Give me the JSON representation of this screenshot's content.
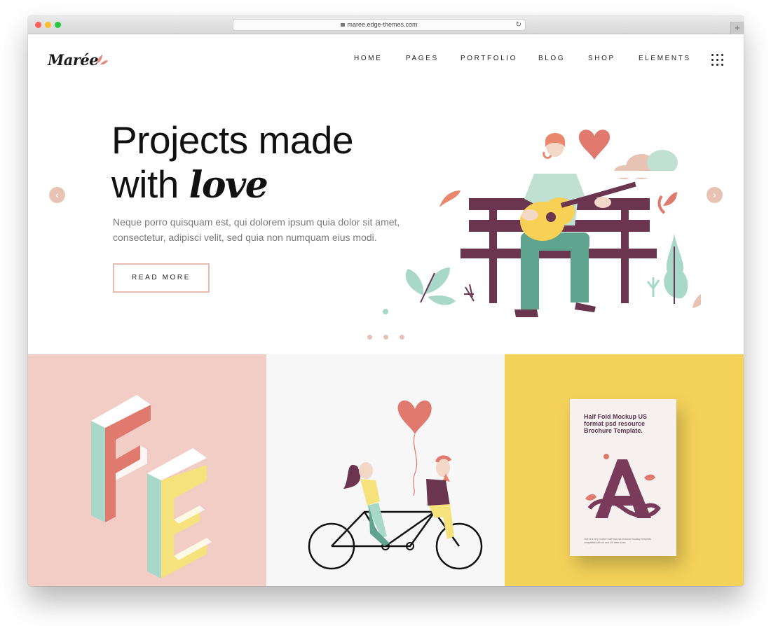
{
  "browser": {
    "url": "maree.edge-themes.com",
    "newtab_label": "+"
  },
  "header": {
    "logo": "Marée",
    "nav": [
      {
        "label": "HOME",
        "active": true
      },
      {
        "label": "PAGES"
      },
      {
        "label": "PORTFOLIO"
      },
      {
        "label": "BLOG"
      },
      {
        "label": "SHOP"
      },
      {
        "label": "ELEMENTS"
      }
    ]
  },
  "hero": {
    "title_line1": "Projects made",
    "title_line2_plain": "with",
    "title_line2_emphasis": "love",
    "text": "Neque porro quisquam est, qui dolorem ipsum quia dolor sit amet, consectetur, adipisci velit, sed quia non numquam eius modi.",
    "button": "READ MORE",
    "prev_icon": "‹",
    "next_icon": "›",
    "slide_count": 3,
    "active_slide": 1
  },
  "tiles": {
    "tile3": {
      "brochure_text": "Half Fold Mockup US format psd resource Brochure Template.",
      "brochure_small": "This is a very modern half fold psd brochure mockup template compatible with A4 and US letter sizes."
    }
  },
  "colors": {
    "accent": "#e8c3b4",
    "tile1": "#f1cdc6",
    "tile2": "#f7f7f7",
    "tile3": "#f4d25a",
    "plum": "#6b3550",
    "mint": "#a8d8c8",
    "coral": "#e07a6e"
  }
}
